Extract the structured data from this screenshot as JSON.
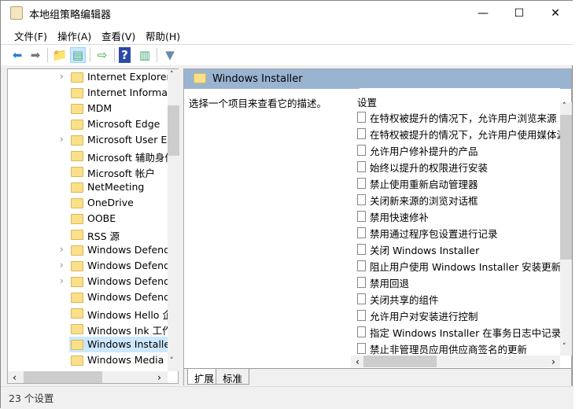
{
  "window": {
    "title": "本地组策略编辑器",
    "minimize": "—",
    "maximize": "☐",
    "close": "✕"
  },
  "menu": [
    "文件(F)",
    "操作(A)",
    "查看(V)",
    "帮助(H)"
  ],
  "toolbar": {
    "back": "back-icon",
    "forward": "forward-icon",
    "up": "up-folder-icon",
    "show_hide_tree": "show-hide-tree-icon",
    "export": "export-list-icon",
    "help": "help-icon",
    "properties": "properties-icon",
    "filter": "filter-icon"
  },
  "tree": {
    "items": [
      {
        "label": "Internet Explorer",
        "expandable": true
      },
      {
        "label": "Internet Informati",
        "expandable": false
      },
      {
        "label": "MDM",
        "expandable": false
      },
      {
        "label": "Microsoft Edge",
        "expandable": false
      },
      {
        "label": "Microsoft User Ex",
        "expandable": true
      },
      {
        "label": "Microsoft 辅助身份",
        "expandable": false
      },
      {
        "label": "Microsoft 帐户",
        "expandable": false
      },
      {
        "label": "NetMeeting",
        "expandable": false
      },
      {
        "label": "OneDrive",
        "expandable": false
      },
      {
        "label": "OOBE",
        "expandable": false
      },
      {
        "label": "RSS 源",
        "expandable": false
      },
      {
        "label": "Windows Defende",
        "expandable": true
      },
      {
        "label": "Windows Defende",
        "expandable": true
      },
      {
        "label": "Windows Defende",
        "expandable": true
      },
      {
        "label": "Windows Defende",
        "expandable": false
      },
      {
        "label": "Windows Hello 企",
        "expandable": false
      },
      {
        "label": "Windows Ink 工作",
        "expandable": false
      },
      {
        "label": "Windows Installer",
        "expandable": false,
        "selected": true
      },
      {
        "label": "Windows Media P",
        "expandable": false
      }
    ]
  },
  "right": {
    "header": "Windows Installer",
    "description": "选择一个项目来查看它的描述。",
    "column": "设置",
    "settings": [
      "在特权被提升的情况下，允许用户浏览来源",
      "在特权被提升的情况下，允许用户使用媒体源",
      "允许用户修补提升的产品",
      "始终以提升的权限进行安装",
      "禁止使用重新启动管理器",
      "关闭新来源的浏览对话框",
      "禁用快速修补",
      "禁用通过程序包设置进行记录",
      "关闭 Windows Installer",
      "阻止用户使用 Windows Installer 安装更新和",
      "禁用回退",
      "关闭共享的组件",
      "允许用户对安装进行控制",
      "指定 Windows Installer 在事务日志中记录的",
      "禁止非管理员应用供应商签名的更新"
    ],
    "tabs": [
      "扩展",
      "标准"
    ]
  },
  "status": "23 个设置"
}
